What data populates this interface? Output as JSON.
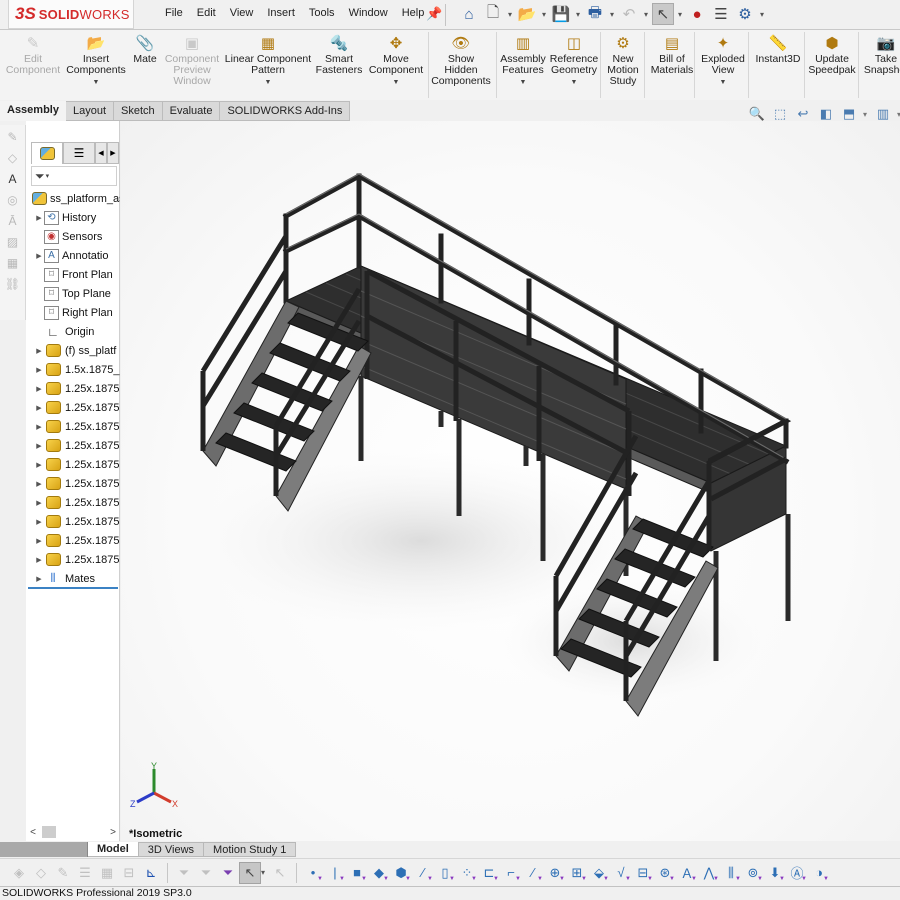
{
  "app": {
    "brand_prefix": "3S",
    "brand_bold": "SOLID",
    "brand_light": "WORKS"
  },
  "menu": [
    "File",
    "Edit",
    "View",
    "Insert",
    "Tools",
    "Window",
    "Help"
  ],
  "quick_access": [
    {
      "name": "home-icon",
      "glyph": "⌂"
    },
    {
      "name": "new-document-icon",
      "glyph": "🗋"
    },
    {
      "name": "open-folder-icon",
      "glyph": "📂"
    },
    {
      "name": "save-icon",
      "glyph": "💾"
    },
    {
      "name": "print-icon",
      "glyph": "🖶"
    },
    {
      "name": "undo-icon",
      "glyph": "↶"
    },
    {
      "name": "select-arrow-icon",
      "glyph": "↖"
    },
    {
      "name": "rebuild-traffic-light-icon",
      "glyph": "●"
    },
    {
      "name": "file-properties-icon",
      "glyph": "☰"
    },
    {
      "name": "options-gear-icon",
      "glyph": "⚙"
    }
  ],
  "ribbon": {
    "buttons": [
      {
        "id": "edit-component",
        "label": "Edit\nComponent",
        "enabled": false,
        "glyph": "✎",
        "dropdown": false
      },
      {
        "id": "insert-components",
        "label": "Insert\nComponents",
        "enabled": true,
        "glyph": "📂",
        "dropdown": true
      },
      {
        "id": "mate",
        "label": "Mate",
        "enabled": true,
        "glyph": "📎",
        "dropdown": false
      },
      {
        "id": "component-preview-window",
        "label": "Component\nPreview\nWindow",
        "enabled": false,
        "glyph": "▣",
        "dropdown": false
      },
      {
        "id": "linear-component-pattern",
        "label": "Linear Component\nPattern",
        "enabled": true,
        "glyph": "▦",
        "dropdown": true
      },
      {
        "id": "smart-fasteners",
        "label": "Smart\nFasteners",
        "enabled": true,
        "glyph": "🔩",
        "dropdown": false
      },
      {
        "id": "move-component",
        "label": "Move\nComponent",
        "enabled": true,
        "glyph": "✥",
        "dropdown": true
      },
      {
        "id": "show-hidden-components",
        "label": "Show\nHidden\nComponents",
        "enabled": true,
        "glyph": "👁",
        "dropdown": false
      },
      {
        "id": "assembly-features",
        "label": "Assembly\nFeatures",
        "enabled": true,
        "glyph": "▥",
        "dropdown": true
      },
      {
        "id": "reference-geometry",
        "label": "Reference\nGeometry",
        "enabled": true,
        "glyph": "◫",
        "dropdown": true
      },
      {
        "id": "new-motion-study",
        "label": "New\nMotion\nStudy",
        "enabled": true,
        "glyph": "⚙",
        "dropdown": false
      },
      {
        "id": "bill-of-materials",
        "label": "Bill of\nMaterials",
        "enabled": true,
        "glyph": "▤",
        "dropdown": false
      },
      {
        "id": "exploded-view",
        "label": "Exploded\nView",
        "enabled": true,
        "glyph": "✦",
        "dropdown": true
      },
      {
        "id": "instant3d",
        "label": "Instant3D",
        "enabled": true,
        "glyph": "📏",
        "dropdown": false
      },
      {
        "id": "update-speedpak",
        "label": "Update\nSpeedpak",
        "enabled": true,
        "glyph": "⬢",
        "dropdown": false
      },
      {
        "id": "take-snapshot",
        "label": "Take\nSnapshot",
        "enabled": true,
        "glyph": "📷",
        "dropdown": false
      }
    ]
  },
  "command_tabs": [
    "Assembly",
    "Layout",
    "Sketch",
    "Evaluate",
    "SOLIDWORKS Add-Ins"
  ],
  "active_command_tab": "Assembly",
  "heads_up_toolbar": [
    {
      "name": "zoom-to-fit-icon",
      "glyph": "🔍"
    },
    {
      "name": "zoom-to-area-icon",
      "glyph": "⬚"
    },
    {
      "name": "previous-view-icon",
      "glyph": "↩"
    },
    {
      "name": "section-view-icon",
      "glyph": "◧"
    },
    {
      "name": "view-orientation-icon",
      "glyph": "⬒"
    },
    {
      "name": "display-style-icon",
      "glyph": "▥"
    }
  ],
  "feature_tree": {
    "root": "ss_platform_assembly",
    "root_display": "ss_platform_as",
    "items": [
      {
        "label": "History",
        "icon": "history",
        "expandable": true
      },
      {
        "label": "Sensors",
        "icon": "sensors",
        "expandable": false
      },
      {
        "label": "Annotations",
        "display": "Annotatio",
        "icon": "annotations",
        "expandable": true
      },
      {
        "label": "Front Plane",
        "display": "Front Plan",
        "icon": "plane",
        "expandable": false
      },
      {
        "label": "Top Plane",
        "display": "Top Plane",
        "icon": "plane",
        "expandable": false
      },
      {
        "label": "Right Plane",
        "display": "Right Plan",
        "icon": "plane",
        "expandable": false
      },
      {
        "label": "Origin",
        "icon": "origin",
        "expandable": false
      },
      {
        "label": "(f) ss_platf",
        "icon": "part",
        "expandable": true
      },
      {
        "label": "1.5x.1875_",
        "icon": "part",
        "expandable": true
      },
      {
        "label": "1.25x.1875",
        "icon": "part",
        "expandable": true
      },
      {
        "label": "1.25x.1875",
        "icon": "part",
        "expandable": true
      },
      {
        "label": "1.25x.1875",
        "icon": "part",
        "expandable": true
      },
      {
        "label": "1.25x.1875",
        "icon": "part",
        "expandable": true
      },
      {
        "label": "1.25x.1875",
        "icon": "part",
        "expandable": true
      },
      {
        "label": "1.25x.1875",
        "icon": "part",
        "expandable": true
      },
      {
        "label": "1.25x.1875",
        "icon": "part",
        "expandable": true
      },
      {
        "label": "1.25x.1875",
        "icon": "part",
        "expandable": true
      },
      {
        "label": "1.25x.1875",
        "icon": "part",
        "expandable": true
      },
      {
        "label": "1.25x.1875",
        "icon": "part",
        "expandable": true
      },
      {
        "label": "Mates",
        "icon": "mates",
        "expandable": true
      }
    ]
  },
  "graphics": {
    "view_name": "*Isometric",
    "triad": {
      "x": "X",
      "y": "Y",
      "z": "Z"
    }
  },
  "bottom_tabs": [
    "Model",
    "3D Views",
    "Motion Study 1"
  ],
  "active_bottom_tab": "Model",
  "status": "SOLIDWORKS Professional 2019 SP3.0",
  "colors": {
    "brand": "#d42a2a",
    "accent": "#3b82c4",
    "part_icon": "#f0c43a",
    "triad_x": "#d23c2c",
    "triad_y": "#2c8a2c",
    "triad_z": "#2c3cc8"
  }
}
